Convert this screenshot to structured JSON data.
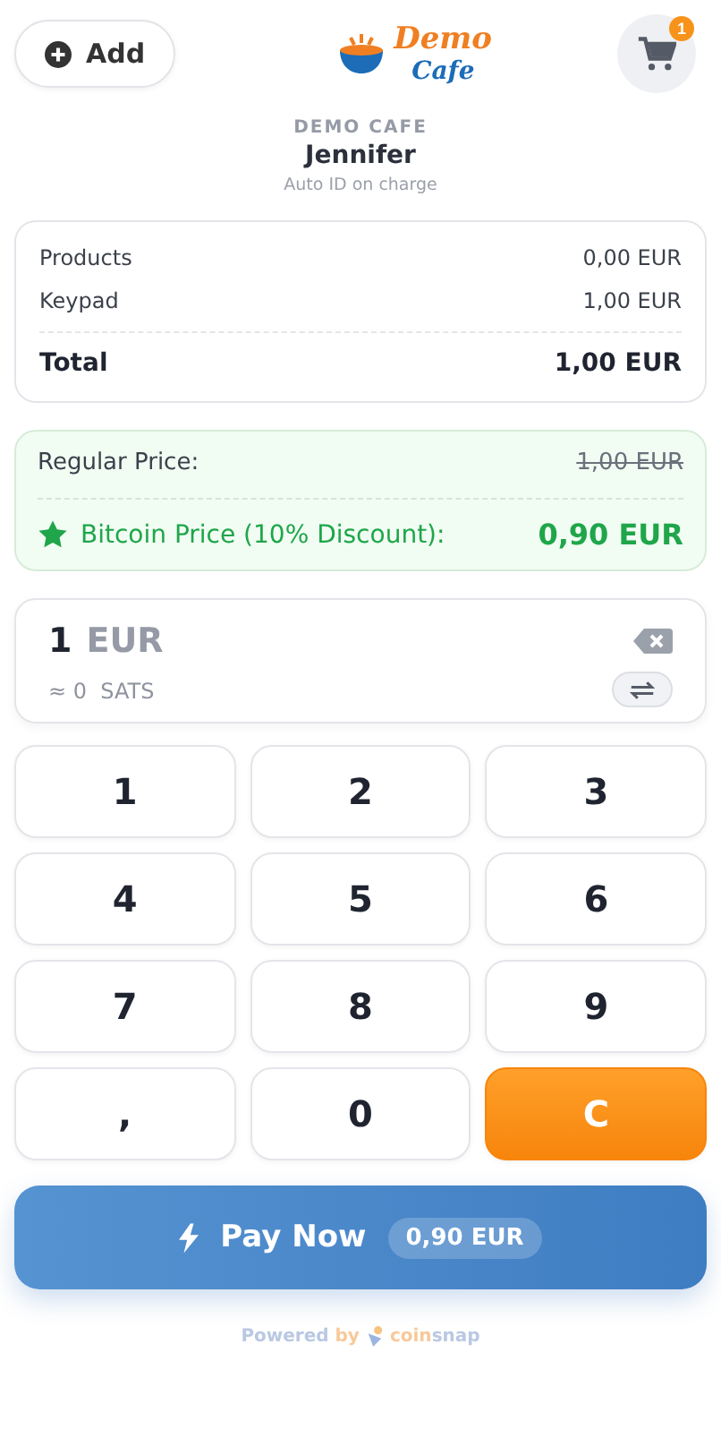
{
  "header": {
    "add_button": "Add",
    "logo": {
      "line_1": "Demo",
      "line_2": "Cafe"
    },
    "cart_count": "1"
  },
  "store": {
    "name": "DEMO CAFE",
    "customer": "Jennifer",
    "note": "Auto ID on charge"
  },
  "summary": {
    "rows": [
      {
        "label": "Products",
        "value": "0,00 EUR"
      },
      {
        "label": "Keypad",
        "value": "1,00 EUR"
      }
    ],
    "total": {
      "label": "Total",
      "value": "1,00 EUR"
    }
  },
  "discount": {
    "regular_label": "Regular Price:",
    "regular_value": "1,00 EUR",
    "bitcoin_label": "Bitcoin Price (10% Discount):",
    "bitcoin_value": "0,90 EUR"
  },
  "amount": {
    "value": "1",
    "currency": "EUR",
    "sats": "≈ 0  SATS"
  },
  "keypad": [
    {
      "label": "1",
      "kind": "digit"
    },
    {
      "label": "2",
      "kind": "digit"
    },
    {
      "label": "3",
      "kind": "digit"
    },
    {
      "label": "4",
      "kind": "digit"
    },
    {
      "label": "5",
      "kind": "digit"
    },
    {
      "label": "6",
      "kind": "digit"
    },
    {
      "label": "7",
      "kind": "digit"
    },
    {
      "label": "8",
      "kind": "digit"
    },
    {
      "label": "9",
      "kind": "digit"
    },
    {
      "label": ",",
      "kind": "digit"
    },
    {
      "label": "0",
      "kind": "digit"
    },
    {
      "label": "C",
      "kind": "clear"
    }
  ],
  "pay_button": {
    "label": "Pay Now",
    "amount": "0,90 EUR"
  },
  "footer": {
    "powered": "Powered",
    "by": "by",
    "brand_a": "coin",
    "brand_b": "snap"
  }
}
